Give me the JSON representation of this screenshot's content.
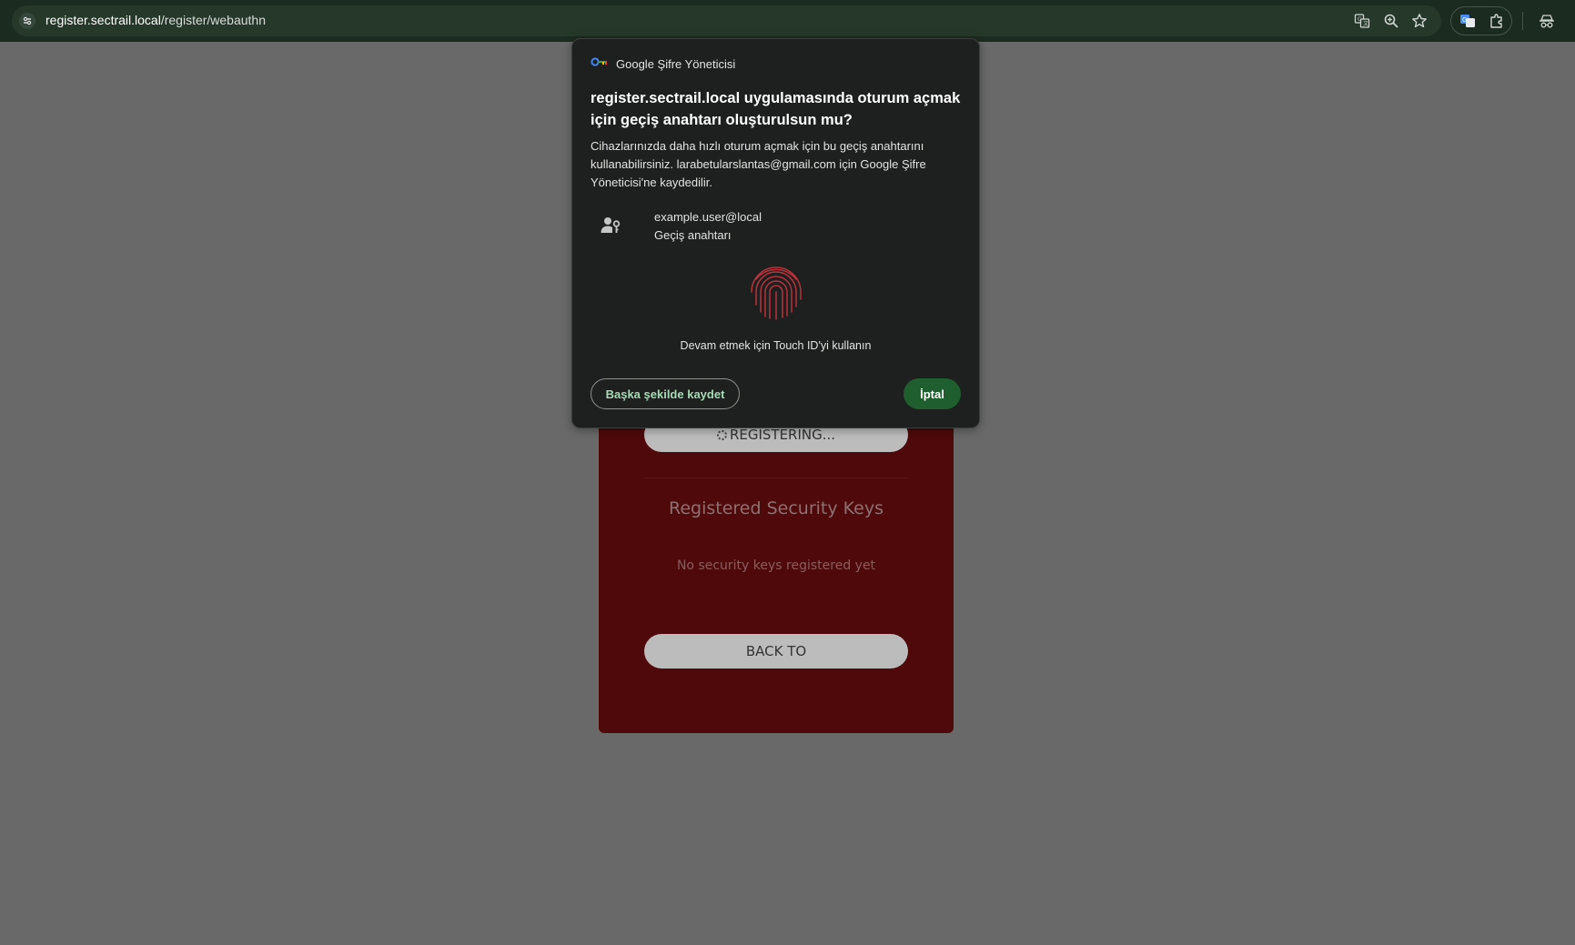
{
  "browser": {
    "url_host": "register.sectrail.local",
    "url_path": "/register/webauthn",
    "icons": [
      "site-info-icon",
      "translate-icon",
      "zoom-icon",
      "bookmark-star-icon",
      "translate-extension-icon",
      "extensions-puzzle-icon",
      "incognito-icon"
    ]
  },
  "page": {
    "registering_label": "REGISTERING...",
    "section_title": "Registered Security Keys",
    "empty_text": "No security keys registered yet",
    "back_label": "BACK TO"
  },
  "dialog": {
    "app_name": "Google Şifre Yöneticisi",
    "title": "register.sectrail.local uygulamasında oturum açmak için geçiş anahtarı oluşturulsun mu?",
    "body": "Cihazlarınızda daha hızlı oturum açmak için bu geçiş anahtarını kullanabilirsiniz. larabetularslantas@gmail.com için Google Şifre Yöneticisi'ne kaydedilir.",
    "account_user": "example.user@local",
    "account_type": "Geçiş anahtarı",
    "touch_text": "Devam etmek için Touch ID'yi kullanın",
    "alt_button": "Başka şekilde kaydet",
    "cancel_button": "İptal"
  },
  "colors": {
    "topbar": "#1c2b1f",
    "page_background": "#696969",
    "card_background": "#4f090a",
    "dialog_background": "#1d201e",
    "primary_button": "#1f5e2f",
    "fingerprint": "#b8323c"
  }
}
